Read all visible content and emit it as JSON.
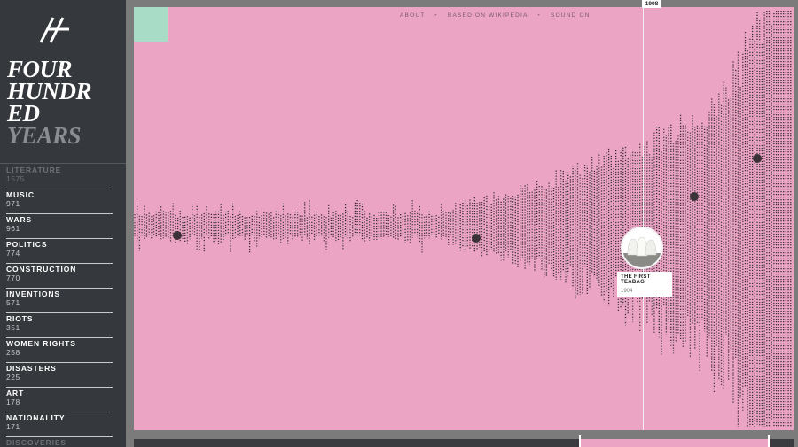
{
  "app": {
    "title_lines": [
      "FOUR",
      "HUNDR",
      "ED"
    ],
    "title_dim": "YEARS"
  },
  "nav": {
    "items": [
      "ABOUT",
      "BASED ON WIKIPEDIA",
      "SOUND ON"
    ],
    "separator": "•"
  },
  "categories": [
    {
      "name": "LITERATURE",
      "count": "1575",
      "active": false
    },
    {
      "name": "MUSIC",
      "count": "971",
      "active": true
    },
    {
      "name": "WARS",
      "count": "961",
      "active": true
    },
    {
      "name": "POLITICS",
      "count": "774",
      "active": true
    },
    {
      "name": "CONSTRUCTION",
      "count": "770",
      "active": true
    },
    {
      "name": "INVENTIONS",
      "count": "571",
      "active": true
    },
    {
      "name": "RIOTS",
      "count": "351",
      "active": true
    },
    {
      "name": "WOMEN RIGHTS",
      "count": "258",
      "active": true
    },
    {
      "name": "DISASTERS",
      "count": "225",
      "active": true
    },
    {
      "name": "ART",
      "count": "178",
      "active": true
    },
    {
      "name": "NATIONALITY",
      "count": "171",
      "active": true
    },
    {
      "name": "DISCOVERIES",
      "count": "",
      "active": false
    }
  ],
  "timeline": {
    "cursor_year": "1908",
    "event": {
      "title": "THE FIRST TEABAG",
      "year": "1904"
    }
  },
  "colors": {
    "sidebar": "#35383c",
    "stage": "#eba4c4",
    "accent": "#a8dcc6",
    "dots": "#3b2e36"
  }
}
